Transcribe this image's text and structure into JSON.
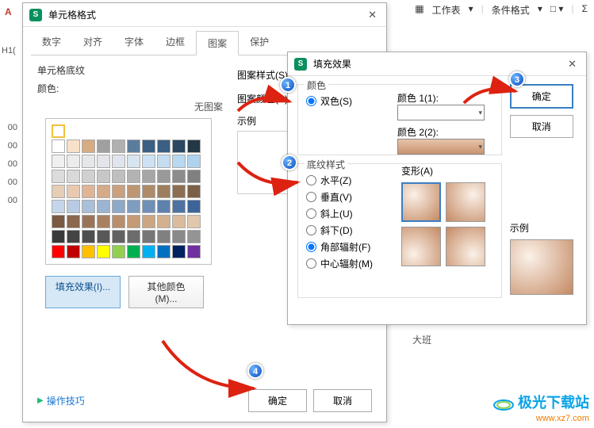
{
  "top_toolbar": {
    "sheet": "工作表",
    "cond": "条件格式",
    "border_ic": "▦",
    "sigma": "Σ"
  },
  "leftvals": [
    "00",
    "00",
    "00",
    "00",
    "00"
  ],
  "row_label": "H1(",
  "misc": "大班",
  "a_icon": "A",
  "dlg_cell": {
    "title": "单元格格式",
    "tabs": [
      "数字",
      "对齐",
      "字体",
      "边框",
      "图案",
      "保护"
    ],
    "active_tab": 4,
    "sub": "单元格底纹",
    "color_label": "颜色:",
    "nopattern": "无图案",
    "pattern_style": "图案样式(S):",
    "pattern_color": "图案颜色(P):",
    "sample": "示例",
    "fill_btn": "填充效果(I)...",
    "other_color_btn": "其他颜色(M)...",
    "tip": "操作技巧",
    "ok": "确定",
    "cancel": "取消"
  },
  "dlg_fill": {
    "title": "填充效果",
    "color_grp": "颜色",
    "two_color": "双色(S)",
    "color1": "颜色 1(1):",
    "color2": "颜色 2(2):",
    "shade_grp": "底纹样式",
    "shades": [
      "水平(Z)",
      "垂直(V)",
      "斜上(U)",
      "斜下(D)",
      "角部辐射(F)",
      "中心辐射(M)"
    ],
    "selected_shade": 4,
    "variants": "变形(A)",
    "sample": "示例",
    "ok": "确定",
    "cancel": "取消"
  },
  "callouts": {
    "c1": "1",
    "c2": "2",
    "c3": "3",
    "c4": "4"
  },
  "logo": {
    "l1": "极光下载站",
    "l2": "www.xz7.com"
  },
  "palette": [
    [
      "#ffffff",
      "#f8e0c9",
      "#d7ab84",
      "#a0a0a0",
      "#b0b0b0",
      "#5b7d9c",
      "#3a5f82",
      "#3a5f82",
      "#2b4761",
      "#233746"
    ],
    [
      "#f0f0f0",
      "#ececec",
      "#e6e7e9",
      "#e3e5ea",
      "#dfe5ee",
      "#d8e5f0",
      "#cce2f4",
      "#c4ddf2",
      "#b7d9f2",
      "#aed3ee"
    ],
    [
      "#dcdcdc",
      "#d9d9d9",
      "#d0d0d0",
      "#c7c7c7",
      "#bfbfbf",
      "#b3b3b3",
      "#a6a6a6",
      "#999999",
      "#8c8c8c",
      "#808080"
    ],
    [
      "#e6cdb5",
      "#e8c9b1",
      "#e0b494",
      "#d6ab8a",
      "#caa07f",
      "#bd9674",
      "#af8b6a",
      "#9e7e5e",
      "#8c6f52",
      "#7b6046"
    ],
    [
      "#c6d6ea",
      "#b8cbe2",
      "#aac0da",
      "#9bb4d1",
      "#8da9c8",
      "#7e9dbf",
      "#6f90b6",
      "#5f82ad",
      "#4e73a3",
      "#3d6498"
    ],
    [
      "#7a5a43",
      "#8a674d",
      "#9a7458",
      "#a98162",
      "#b98e6c",
      "#c49a77",
      "#cca683",
      "#d3b190",
      "#dabc9d",
      "#e1c7ab"
    ],
    [
      "#3a3a3a",
      "#444444",
      "#4e4e4e",
      "#585858",
      "#626262",
      "#6c6c6c",
      "#767676",
      "#808080",
      "#8a8a8a",
      "#949494"
    ],
    [
      "#ff0000",
      "#c00000",
      "#ffc000",
      "#ffff00",
      "#92d050",
      "#00b050",
      "#00b0f0",
      "#0070c0",
      "#002060",
      "#7030a0"
    ]
  ]
}
